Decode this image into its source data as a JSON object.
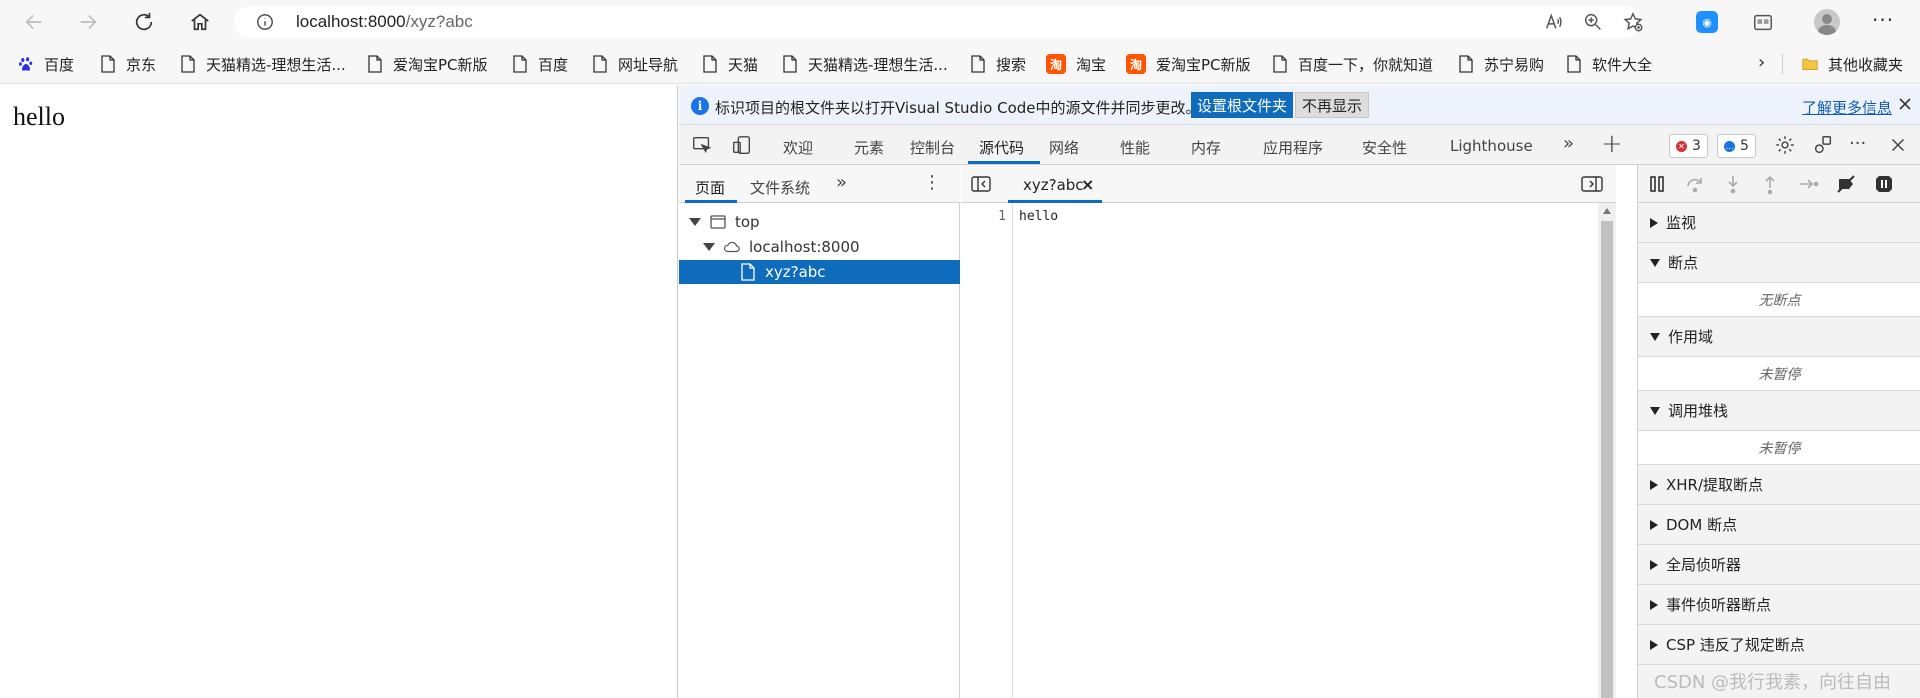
{
  "browser": {
    "url_host": "localhost:8000",
    "url_path": "/xyz?abc",
    "bookmarks": [
      {
        "label": "百度",
        "icon": "baidu-paw-icon"
      },
      {
        "label": "京东",
        "icon": "page-icon"
      },
      {
        "label": "天猫精选-理想生活...",
        "icon": "page-icon"
      },
      {
        "label": "爱淘宝PC新版",
        "icon": "page-icon"
      },
      {
        "label": "百度",
        "icon": "page-icon"
      },
      {
        "label": "网址导航",
        "icon": "page-icon"
      },
      {
        "label": "天猫",
        "icon": "page-icon"
      },
      {
        "label": "天猫精选-理想生活...",
        "icon": "page-icon"
      },
      {
        "label": "搜索",
        "icon": "page-icon"
      },
      {
        "label": "淘宝",
        "icon": "taobao-icon"
      },
      {
        "label": "爱淘宝PC新版",
        "icon": "taobao-icon"
      },
      {
        "label": "百度一下，你就知道",
        "icon": "page-icon"
      },
      {
        "label": "苏宁易购",
        "icon": "page-icon"
      },
      {
        "label": "软件大全",
        "icon": "page-icon"
      }
    ],
    "other_bookmarks": "其他收藏夹"
  },
  "page": {
    "content": "hello"
  },
  "devtools": {
    "infobar": {
      "message": "标识项目的根文件夹以打开Visual Studio Code中的源文件并同步更改。",
      "primary_button": "设置根文件夹",
      "secondary_button": "不再显示",
      "learn_more": "了解更多信息"
    },
    "tabs": [
      "欢迎",
      "元素",
      "控制台",
      "源代码",
      "网络",
      "性能",
      "内存",
      "应用程序",
      "安全性",
      "Lighthouse"
    ],
    "active_tab": "源代码",
    "errors_count": "3",
    "messages_count": "5",
    "navigator": {
      "tabs": [
        "页面",
        "文件系统"
      ],
      "tree": {
        "top": "top",
        "host": "localhost:8000",
        "file": "xyz?abc"
      }
    },
    "editor": {
      "tab_label": "xyz?abc",
      "close_glyph": "×",
      "line_number": "1",
      "code": "hello"
    },
    "debugger": {
      "sections": {
        "watch": "监视",
        "breakpoints": "断点",
        "breakpoints_empty": "无断点",
        "scope": "作用域",
        "scope_empty": "未暂停",
        "callstack": "调用堆栈",
        "callstack_empty": "未暂停",
        "xhr": "XHR/提取断点",
        "dom": "DOM 断点",
        "global": "全局侦听器",
        "event": "事件侦听器断点",
        "csp": "CSP 违反了规定断点"
      }
    }
  },
  "watermark": "CSDN @我行我素，向往自由",
  "colors": {
    "accent": "#0f6cbd",
    "error": "#d13438",
    "message": "#1a73e8"
  }
}
